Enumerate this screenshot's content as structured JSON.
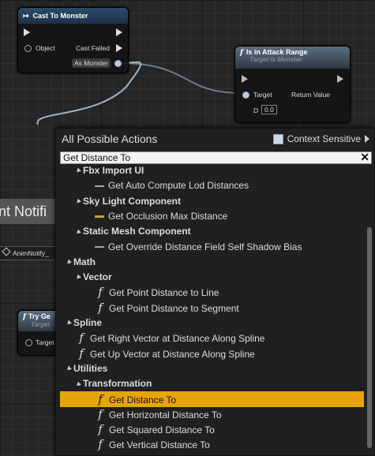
{
  "graph": {
    "cast_node": {
      "title": "Cast To Monster",
      "object_label": "Object",
      "cast_failed_label": "Cast Failed",
      "as_monster_label": "As Monster"
    },
    "range_node": {
      "title": "Is in Attack Range",
      "subtitle": "Target is Monster",
      "target_label": "Target",
      "return_label": "Return Value",
      "d_label": "D",
      "d_value": "0.0"
    },
    "left_title": "nt Notifi",
    "anim_notify_label": "AnimNotify_",
    "try_node": {
      "title": "Try Ge",
      "subtitle": "Target",
      "target_label": "Target"
    }
  },
  "menu": {
    "title": "All Possible Actions",
    "context_sensitive_label": "Context Sensitive",
    "search_value": "Get Distance To",
    "clear_icon": "✕",
    "rows": [
      {
        "label": "Fbx Import UI",
        "kind": "cat",
        "indent": 1
      },
      {
        "label": "Get Auto Compute Lod Distances",
        "kind": "dash",
        "indent": 2
      },
      {
        "label": "Sky Light Component",
        "kind": "cat",
        "indent": 1
      },
      {
        "label": "Get Occlusion Max Distance",
        "kind": "dash-gold",
        "indent": 2
      },
      {
        "label": "Static Mesh Component",
        "kind": "cat",
        "indent": 1
      },
      {
        "label": "Get Override Distance Field Self Shadow Bias",
        "kind": "dash",
        "indent": 2
      },
      {
        "label": "Math",
        "kind": "cat",
        "indent": 0
      },
      {
        "label": "Vector",
        "kind": "cat",
        "indent": 1
      },
      {
        "label": "Get Point Distance to Line",
        "kind": "func",
        "indent": 2
      },
      {
        "label": "Get Point Distance to Segment",
        "kind": "func",
        "indent": 2
      },
      {
        "label": "Spline",
        "kind": "cat",
        "indent": 0
      },
      {
        "label": "Get Right Vector at Distance Along Spline",
        "kind": "func",
        "indent": 1
      },
      {
        "label": "Get Up Vector at Distance Along Spline",
        "kind": "func",
        "indent": 1
      },
      {
        "label": "Utilities",
        "kind": "cat",
        "indent": 0
      },
      {
        "label": "Transformation",
        "kind": "cat",
        "indent": 1
      },
      {
        "label": "Get Distance To",
        "kind": "func",
        "indent": 2,
        "selected": true
      },
      {
        "label": "Get Horizontal Distance To",
        "kind": "func",
        "indent": 2
      },
      {
        "label": "Get Squared Distance To",
        "kind": "func",
        "indent": 2
      },
      {
        "label": "Get Vertical Distance To",
        "kind": "func",
        "indent": 2
      }
    ]
  },
  "colors": {
    "selection": "#e5a50a",
    "cast_header": "#2b4a6b",
    "func_header": "#3a5f85"
  }
}
